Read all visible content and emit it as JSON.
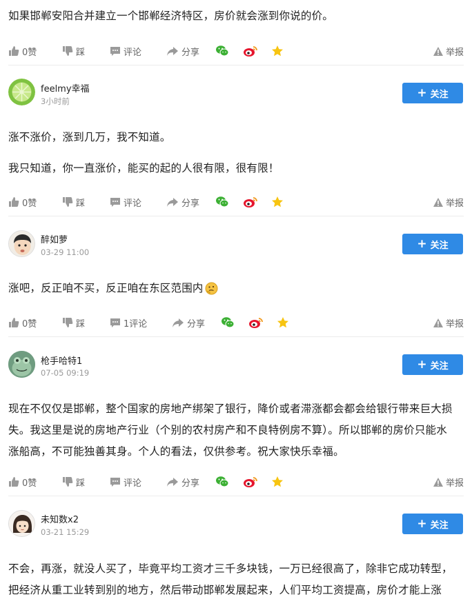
{
  "posts": [
    {
      "lines": [
        "如果邯郸安阳合并建立一个邯郸经济特区，房价就会涨到你说的价。"
      ],
      "actions": {
        "like": "0赞",
        "dislike": "踩",
        "comment": "评论",
        "share": "分享",
        "report": "举报"
      }
    },
    {
      "user": {
        "name": "feelmy幸福",
        "time": "3小时前",
        "follow": "关注",
        "avatar_icon": "lime-avatar"
      },
      "lines": [
        "涨不涨价，涨到几万，我不知道。",
        "我只知道，你一直涨价，能买的起的人很有限，很有限！"
      ],
      "actions": {
        "like": "0赞",
        "dislike": "踩",
        "comment": "评论",
        "share": "分享",
        "report": "举报"
      }
    },
    {
      "user": {
        "name": "醉如萝",
        "time": "03-29 11:00",
        "follow": "关注",
        "avatar_icon": "boy-avatar"
      },
      "lines": [
        "涨吧，反正咱不买，反正咱在东区范围内"
      ],
      "emoji": "thinking-emoji",
      "actions": {
        "like": "0赞",
        "dislike": "踩",
        "comment": "1评论",
        "share": "分享",
        "report": "举报"
      }
    },
    {
      "user": {
        "name": "枪手哈特1",
        "time": "07-05 09:19",
        "follow": "关注",
        "avatar_icon": "frog-avatar"
      },
      "lines": [
        "现在不仅仅是邯郸，整个国家的房地产绑架了银行，降价或者滞涨都会都会给银行带来巨大损",
        "失。我这里是说的房地产行业（个别的农村房产和不良特例房不算）。所以邯郸的房价只能水",
        "涨船高，不可能独善其身。个人的看法，仅供参考。祝大家快乐幸福。"
      ],
      "actions": {
        "like": "0赞",
        "dislike": "踩",
        "comment": "评论",
        "share": "分享",
        "report": "举报"
      }
    },
    {
      "user": {
        "name": "未知数x2",
        "time": "03-21 15:29",
        "follow": "关注",
        "avatar_icon": "girl-avatar"
      },
      "lines": [
        "不会，再涨，就没人买了，毕竟平均工资才三千多块钱，一万已经很高了，除非它成功转型，",
        "把经济从重工业转到别的地方，然后带动邯郸发展起来，人们平均工资提高，房价才能上涨"
      ]
    }
  ],
  "colors": {
    "accent": "#2f8ae5",
    "wechat": "#3cb034",
    "weibo": "#e6162d",
    "star": "#f7c411"
  }
}
